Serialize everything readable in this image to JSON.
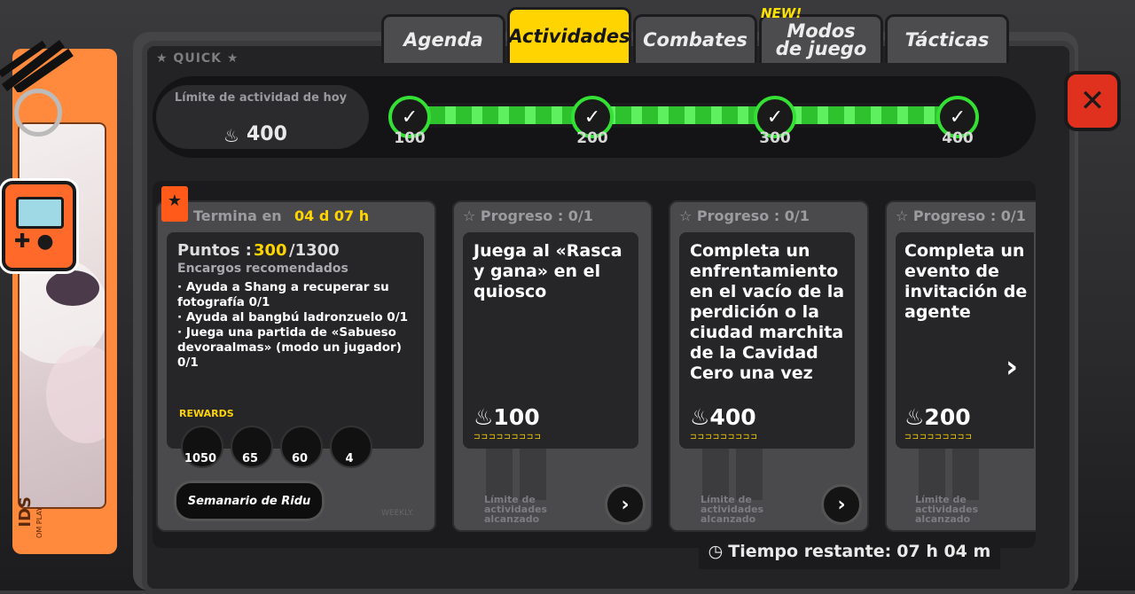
{
  "tabs": [
    {
      "label": "Agenda"
    },
    {
      "label": "Actividades"
    },
    {
      "label": "Combates"
    },
    {
      "label": "Modos de juego"
    },
    {
      "label": "Tácticas"
    }
  ],
  "new_badge": "NEW!",
  "quick_label": "★ QUICK ★",
  "daily_limit": {
    "label": "Límite de actividad de hoy",
    "value": "400"
  },
  "progress": {
    "fraction": 1.0,
    "milestones": [
      "100",
      "200",
      "300",
      "400"
    ]
  },
  "first_card": {
    "ends_label": "Termina en",
    "ends_value": "04 d 07 h",
    "points_label": "Puntos :",
    "points_current": "300",
    "points_total": "/1300",
    "recommended_label": "Encargos recomendados",
    "tasks": [
      "· Ayuda a Shang a recuperar su fotografía 0/1",
      "· Ayuda al bangbú ladronzuelo 0/1",
      "· Juega una partida de «Sabueso devoraalmas» (modo un jugador) 0/1"
    ],
    "rewards_label": "REWARDS",
    "rewards": [
      {
        "count": "1050"
      },
      {
        "count": "65"
      },
      {
        "count": "60"
      },
      {
        "count": "4"
      }
    ],
    "weekly_button": "Semanario de Ridu",
    "weekly_tag": "WEEKLY."
  },
  "cards": [
    {
      "progress": "Progreso : 0/1",
      "title": "Juega al «Rasca y gana» en el quiosco",
      "points": "100",
      "limit_text": "Límite de actividades alcanzado"
    },
    {
      "progress": "Progreso : 0/1",
      "title": "Completa un enfrentamiento en el vacío de la perdición o la ciudad marchita de la Cavidad Cero una vez",
      "points": "400",
      "limit_text": "Límite de actividades alcanzado"
    },
    {
      "progress": "Progreso : 0/1",
      "title": "Completa un evento de invitación de agente",
      "points": "200",
      "limit_text": "Límite de actividades alcanzado"
    }
  ],
  "remaining": {
    "label": "Tiempo restante:",
    "value": "07 h 04 m"
  },
  "side_text": "IDS",
  "side_small": "OM PLAY",
  "colors": {
    "accent": "#ffd400",
    "progress": "#34e034",
    "close": "#e0301e",
    "pendant": "#ff8a3d"
  }
}
